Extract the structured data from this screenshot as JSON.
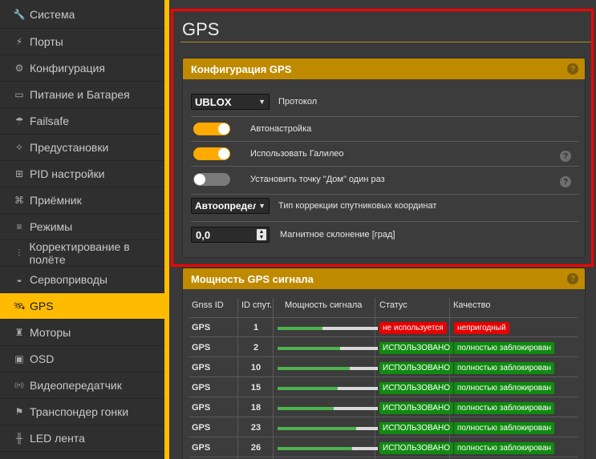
{
  "sidebar": {
    "items": [
      {
        "label": "Система",
        "icon": "wrench-icon",
        "glyph": "🔧"
      },
      {
        "label": "Порты",
        "icon": "plug-icon",
        "glyph": "⚡"
      },
      {
        "label": "Конфигурация",
        "icon": "gear-icon",
        "glyph": "⚙"
      },
      {
        "label": "Питание и Батарея",
        "icon": "battery-icon",
        "glyph": "▭"
      },
      {
        "label": "Failsafe",
        "icon": "parachute-icon",
        "glyph": "☂"
      },
      {
        "label": "Предустановки",
        "icon": "wand-icon",
        "glyph": "✧"
      },
      {
        "label": "PID настройки",
        "icon": "sitemap-icon",
        "glyph": "⊞"
      },
      {
        "label": "Приёмник",
        "icon": "receiver-icon",
        "glyph": "⌘"
      },
      {
        "label": "Режимы",
        "icon": "toggles-icon",
        "glyph": "≡"
      },
      {
        "label": "Корректирование в полёте",
        "icon": "sliders-icon",
        "glyph": "⫶"
      },
      {
        "label": "Сервоприводы",
        "icon": "servo-icon",
        "glyph": "◒"
      },
      {
        "label": "GPS",
        "icon": "satellite-icon",
        "glyph": "🛰",
        "active": true
      },
      {
        "label": "Моторы",
        "icon": "motor-icon",
        "glyph": "♜"
      },
      {
        "label": "OSD",
        "icon": "osd-icon",
        "glyph": "▣"
      },
      {
        "label": "Видеопередатчик",
        "icon": "broadcast-icon",
        "glyph": "((•))"
      },
      {
        "label": "Транспондер гонки",
        "icon": "transponder-icon",
        "glyph": "⚑"
      },
      {
        "label": "LED лента",
        "icon": "led-icon",
        "glyph": "╫"
      }
    ]
  },
  "page": {
    "title": "GPS"
  },
  "gps_config": {
    "header": "Конфигурация GPS",
    "help_glyph": "?",
    "protocol": {
      "value": "UBLOX",
      "label": "Протокол"
    },
    "auto_config": {
      "label": "Автонастройка",
      "on": true
    },
    "galileo": {
      "label": "Использовать Галилео",
      "on": true
    },
    "home_once": {
      "label": "Установить точку \"Дом\" один раз",
      "on": false
    },
    "correction": {
      "value": "Автоопредел",
      "label": "Тип коррекции спутниковых координат"
    },
    "declination": {
      "value": "0,0",
      "label": "Магнитное склонение [град]"
    }
  },
  "signal": {
    "header": "Мощность GPS сигнала",
    "columns": [
      "Gnss ID",
      "ID спут.",
      "Мощность сигнала",
      "Статус",
      "Качество"
    ],
    "rows": [
      {
        "gnss": "GPS",
        "id": "1",
        "strength": 0.45,
        "status": "не используется",
        "status_color": "red",
        "quality": "непригодный",
        "quality_color": "red"
      },
      {
        "gnss": "GPS",
        "id": "2",
        "strength": 0.62,
        "status": "ИСПОЛЬЗОВАНО",
        "status_color": "green",
        "quality": "полностью заблокирован",
        "quality_color": "green"
      },
      {
        "gnss": "GPS",
        "id": "10",
        "strength": 0.72,
        "status": "ИСПОЛЬЗОВАНО",
        "status_color": "green",
        "quality": "полностью заблокирован",
        "quality_color": "green"
      },
      {
        "gnss": "GPS",
        "id": "15",
        "strength": 0.6,
        "status": "ИСПОЛЬЗОВАНО",
        "status_color": "green",
        "quality": "полностью заблокирован",
        "quality_color": "green"
      },
      {
        "gnss": "GPS",
        "id": "18",
        "strength": 0.56,
        "status": "ИСПОЛЬЗОВАНО",
        "status_color": "green",
        "quality": "полностью заблокирован",
        "quality_color": "green"
      },
      {
        "gnss": "GPS",
        "id": "23",
        "strength": 0.78,
        "status": "ИСПОЛЬЗОВАНО",
        "status_color": "green",
        "quality": "полностью заблокирован",
        "quality_color": "green"
      },
      {
        "gnss": "GPS",
        "id": "26",
        "strength": 0.74,
        "status": "ИСПОЛЬЗОВАНО",
        "status_color": "green",
        "quality": "полностью заблокирован",
        "quality_color": "green"
      }
    ]
  },
  "colors": {
    "accent": "#ffbb00",
    "panel_header": "#c08a00",
    "highlight": "#ff0000",
    "ok": "#118a11",
    "bad": "#e60000"
  }
}
